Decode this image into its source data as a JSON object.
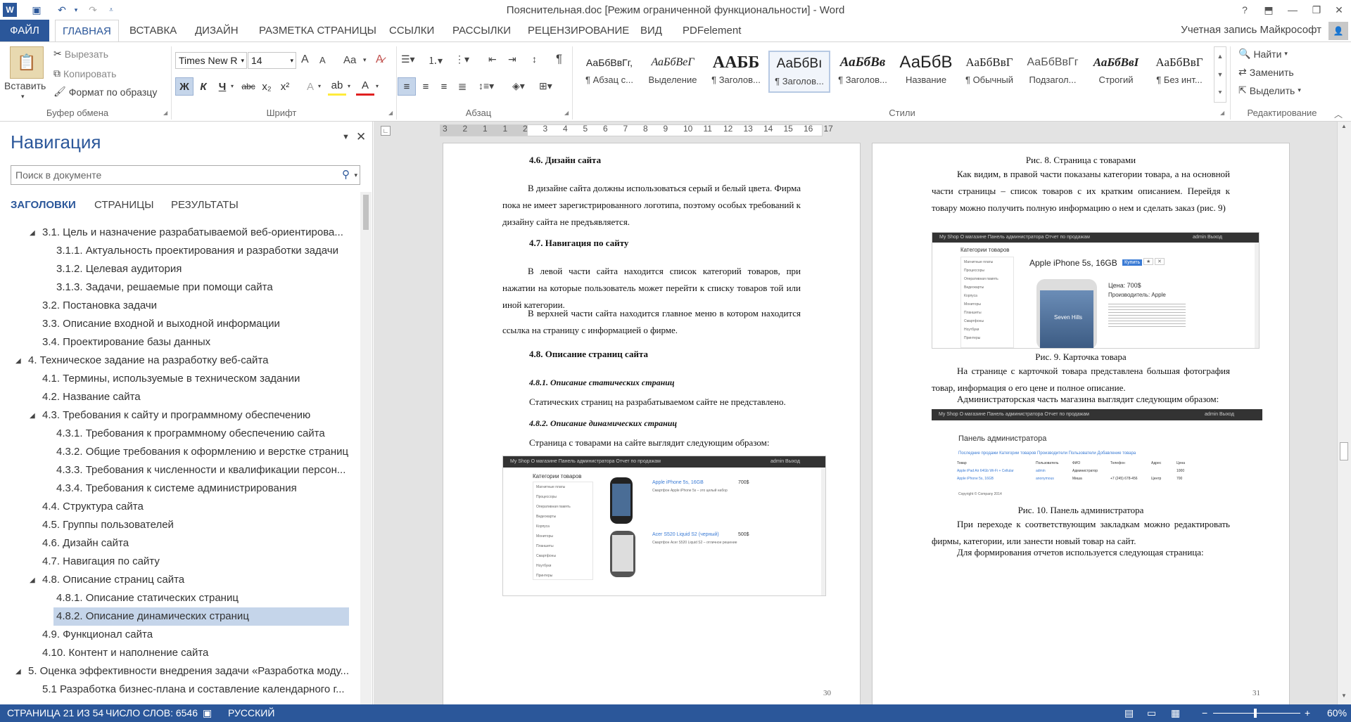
{
  "window": {
    "title": "Пояснительная.doc [Режим ограниченной функциональности] - Word"
  },
  "ribbon": {
    "tabs": [
      "ФАЙЛ",
      "ГЛАВНАЯ",
      "ВСТАВКА",
      "ДИЗАЙН",
      "РАЗМЕТКА СТРАНИЦЫ",
      "ССЫЛКИ",
      "РАССЫЛКИ",
      "РЕЦЕНЗИРОВАНИЕ",
      "ВИД",
      "PDFelement"
    ],
    "active_tab": "ГЛАВНАЯ",
    "account": "Учетная запись Майкрософт",
    "clipboard": {
      "paste": "Вставить",
      "cut": "Вырезать",
      "copy": "Копировать",
      "format_painter": "Формат по образцу",
      "label": "Буфер обмена"
    },
    "font": {
      "name": "Times New R",
      "size": "14",
      "label": "Шрифт",
      "bold": "Ж",
      "italic": "К",
      "underline": "Ч",
      "strike": "abc",
      "subscript": "x₂",
      "superscript": "x²",
      "grow": "A",
      "shrink": "A",
      "case": "Aa"
    },
    "paragraph": {
      "label": "Абзац",
      "pilcrow": "¶"
    },
    "styles": {
      "label": "Стили",
      "items": [
        {
          "sample": "АаБбВвГг,",
          "name": "¶ Абзац с..."
        },
        {
          "sample": "АаБбВеГ",
          "name": "Выделение"
        },
        {
          "sample": "ААББ",
          "name": "¶ Заголов..."
        },
        {
          "sample": "АаБбВı",
          "name": "¶ Заголов..."
        },
        {
          "sample": "АаБбВв",
          "name": "¶ Заголов..."
        },
        {
          "sample": "АаБбВ",
          "name": "Название"
        },
        {
          "sample": "АаБбВвГ",
          "name": "¶ Обычный"
        },
        {
          "sample": "АаБбВвГг",
          "name": "Подзагол..."
        },
        {
          "sample": "АаБбВвI",
          "name": "Строгий"
        },
        {
          "sample": "АаБбВвГ",
          "name": "¶ Без инт..."
        }
      ]
    },
    "editing": {
      "label": "Редактирование",
      "find": "Найти",
      "replace": "Заменить",
      "select": "Выделить"
    }
  },
  "navigation": {
    "title": "Навигация",
    "search_placeholder": "Поиск в документе",
    "tabs": [
      "ЗАГОЛОВКИ",
      "СТРАНИЦЫ",
      "РЕЗУЛЬТАТЫ"
    ],
    "items": [
      {
        "text": "3.1. Цель и назначение разрабатываемой веб-ориентирова...",
        "level": 2,
        "expanded": true
      },
      {
        "text": "3.1.1. Актуальность проектирования и разработки задачи",
        "level": 3
      },
      {
        "text": "3.1.2. Целевая аудитория",
        "level": 3
      },
      {
        "text": "3.1.3. Задачи, решаемые при помощи сайта",
        "level": 3
      },
      {
        "text": "3.2. Постановка задачи",
        "level": 2
      },
      {
        "text": "3.3. Описание входной и выходной информации",
        "level": 2
      },
      {
        "text": "3.4. Проектирование базы данных",
        "level": 2
      },
      {
        "text": "4. Техническое задание на разработку веб-сайта",
        "level": 1,
        "expanded": true
      },
      {
        "text": "4.1. Термины, используемые в техническом задании",
        "level": 2
      },
      {
        "text": "4.2. Название сайта",
        "level": 2
      },
      {
        "text": "4.3. Требования к сайту и программному обеспечению",
        "level": 2,
        "expanded": true
      },
      {
        "text": "4.3.1. Требования к программному обеспечению сайта",
        "level": 3
      },
      {
        "text": "4.3.2. Общие требования к оформлению и верстке страниц",
        "level": 3
      },
      {
        "text": "4.3.3. Требования к численности и квалификации персон...",
        "level": 3
      },
      {
        "text": "4.3.4. Требования к системе администрирования",
        "level": 3
      },
      {
        "text": "4.4. Структура сайта",
        "level": 2
      },
      {
        "text": "4.5. Группы пользователей",
        "level": 2
      },
      {
        "text": "4.6. Дизайн сайта",
        "level": 2
      },
      {
        "text": "4.7. Навигация по сайту",
        "level": 2
      },
      {
        "text": "4.8. Описание страниц сайта",
        "level": 2,
        "expanded": true
      },
      {
        "text": "4.8.1. Описание статических страниц",
        "level": 3
      },
      {
        "text": "4.8.2. Описание динамических страниц",
        "level": 3,
        "selected": true
      },
      {
        "text": "4.9. Функционал сайта",
        "level": 2
      },
      {
        "text": "4.10. Контент и наполнение сайта",
        "level": 2
      },
      {
        "text": "5. Оценка эффективности внедрения задачи «Разработка моду...",
        "level": 1,
        "expanded": true
      },
      {
        "text": "5.1 Разработка бизнес-плана и составление календарного г...",
        "level": 2
      }
    ]
  },
  "ruler": {
    "numbers": [
      "3",
      "2",
      "1",
      "1",
      "2",
      "3",
      "4",
      "5",
      "6",
      "7",
      "8",
      "9",
      "10",
      "11",
      "12",
      "13",
      "14",
      "15",
      "16",
      "17"
    ]
  },
  "page_left": {
    "h46": "4.6. Дизайн сайта",
    "p1": "В дизайне сайта должны использоваться серый и белый цвета. Фирма пока не имеет зарегистрированного логотипа, поэтому особых требований к дизайну сайта не предъявляется.",
    "h47": "4.7. Навигация по сайту",
    "p2": "В левой части сайта находится список категорий товаров, при нажатии на которые пользователь может перейти к списку товаров той или иной категории.",
    "p3": "В верхней части сайта находится главное меню в котором находится ссылка на страницу с информацией о фирме.",
    "h48": "4.8. Описание страниц сайта",
    "h481": "4.8.1. Описание статических страниц",
    "p4": "Статических страниц на разрабатываемом сайте не представлено.",
    "h482": "4.8.2. Описание динамических страниц",
    "p5": "Страница с товарами на сайте выглядит следующим образом:",
    "page_num": "30",
    "shot": {
      "nav": "My Shop     О магазине     Панель администратора     Отчет по продажам",
      "nav_right": "admin     Выход",
      "categories_title": "Категории товаров",
      "categories": [
        "Магнитные платы",
        "Процессоры",
        "Оперативная память",
        "Видеокарты",
        "Корпуса",
        "Мониторы",
        "Планшеты",
        "Смартфоны",
        "Ноутбуки",
        "Принтеры"
      ],
      "item1_name": "Apple iPhone 5s, 16GB",
      "item1_price": "700$",
      "item1_desc": "Смартфон Apple iPhone 5s – это целый набор",
      "item2_name": "Acer S520 Liquid S2 (черный)",
      "item2_price": "500$",
      "item2_desc": "Смартфон Acer S520 Liquid S2 – отличное решение"
    }
  },
  "page_right": {
    "cap8": "Рис. 8. Страница с товарами",
    "p1": "Как видим, в правой части показаны категории товара, а на основной части страницы – список товаров с их кратким описанием. Перейдя к товару можно получить полную информацию о нем и сделать заказ (рис. 9)",
    "cap9": "Рис. 9. Карточка товара",
    "p2": "На странице с карточкой товара представлена большая фотография товар, информация о его цене и полное описание.",
    "p3": "Администраторская часть магазина выглядит следующим образом:",
    "cap10": "Рис. 10. Панель администратора",
    "p4": "При переходе к соответствующим закладкам можно редактировать фирмы, категории, или занести новый товар на сайт.",
    "p5": "Для формирования отчетов используется следующая страница:",
    "page_num": "31",
    "shot9": {
      "nav": "My Shop     О магазине     Панель администратора     Отчет по продажам",
      "nav_right": "admin     Выход",
      "categories_title": "Категории товаров",
      "categories": [
        "Магнитные платы",
        "Процессоры",
        "Оперативная память",
        "Видеокарты",
        "Корпуса",
        "Мониторы",
        "Планшеты",
        "Смартфоны",
        "Ноутбуки",
        "Принтеры"
      ],
      "product": "Apple iPhone 5s, 16GB",
      "buy": "Купить",
      "price": "Цена: 700$",
      "maker": "Производитель: Apple",
      "phone_text": "Seven Hills"
    },
    "shot10": {
      "nav": "My Shop     О магазине     Панель администратора     Отчет по продажам",
      "nav_right": "admin     Выход",
      "title": "Панель администратора",
      "tabs": "Последние продажи     Категории товаров     Производители     Пользователи     Добавление товара",
      "headers": [
        "Товар",
        "Пользователь",
        "ФИО",
        "Телефон",
        "Адрес",
        "Цена"
      ],
      "row1": [
        "Apple iPad Air 64Gb Wi-Fi + Cellular",
        "admin",
        "Администратор",
        "",
        "",
        "1000"
      ],
      "row2": [
        "Apple iPhone 5s, 16GB",
        "anonymous",
        "Миша",
        "+7 (245) 678-456",
        "Центр",
        "700"
      ],
      "footer": "Copyright © Company 2014"
    }
  },
  "status": {
    "page": "СТРАНИЦА 21 ИЗ 54",
    "words": "ЧИСЛО СЛОВ: 6546",
    "lang": "РУССКИЙ",
    "zoom": "60%",
    "zoom_level": 0.6
  }
}
